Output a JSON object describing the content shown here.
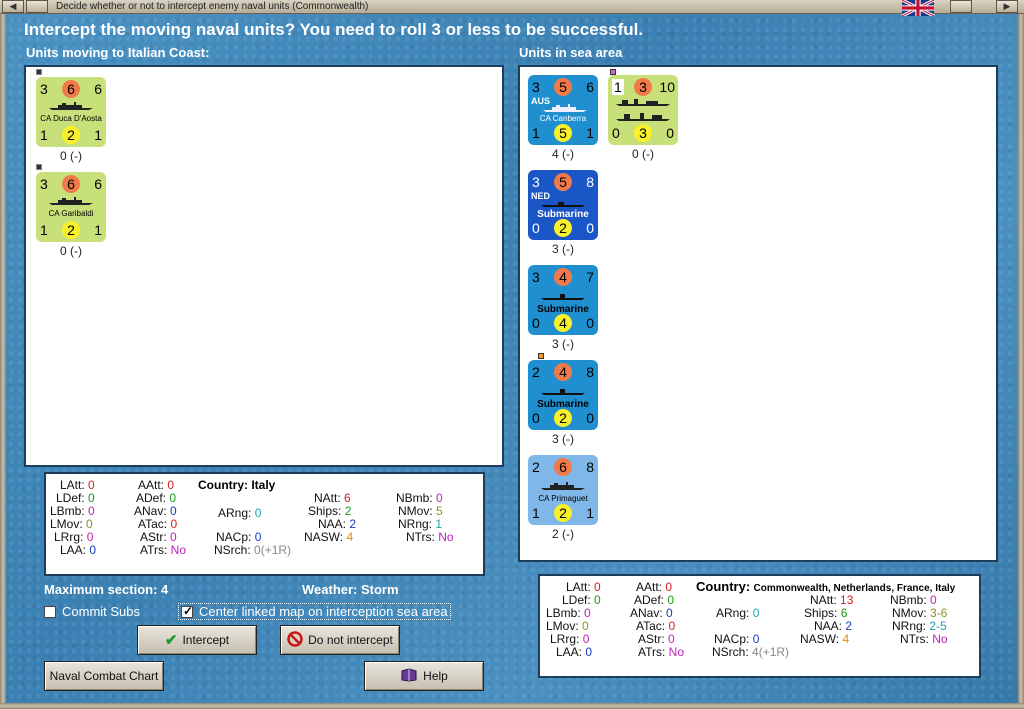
{
  "window": {
    "title": "Decide whether or not to intercept enemy naval units (Commonwealth)",
    "left_btn": "◀",
    "right_btn": "▶"
  },
  "headline": "Intercept the moving naval units?  You need to roll 3 or less to be successful.",
  "left_section": {
    "label": "Units moving to Italian Coast:",
    "units": [
      {
        "tl": "3",
        "tc": "6",
        "tr": "6",
        "name": "CA Duca D'Aosta",
        "bl": "1",
        "bc": "2",
        "br": "1",
        "caption": "0 (-)"
      },
      {
        "tl": "3",
        "tc": "6",
        "tr": "6",
        "name": "CA Garibaldi",
        "bl": "1",
        "bc": "2",
        "br": "1",
        "caption": "0 (-)"
      }
    ]
  },
  "right_section": {
    "label": "Units in sea area",
    "units": [
      {
        "tl": "3",
        "tc": "5",
        "tr": "6",
        "country": "AUS",
        "name": "CA Canberra",
        "bl": "1",
        "bc": "5",
        "br": "1",
        "caption": "4 (-)"
      },
      {
        "tl": "1",
        "tc": "3",
        "tr": "10",
        "country": "",
        "name": "",
        "bl": "0",
        "bc": "3",
        "br": "0",
        "caption": "0 (-)"
      },
      {
        "tl": "3",
        "tc": "5",
        "tr": "8",
        "country": "NED",
        "name": "Submarine",
        "bl": "0",
        "bc": "2",
        "br": "0",
        "caption": "3 (-)"
      },
      {
        "tl": "3",
        "tc": "4",
        "tr": "7",
        "country": "",
        "name": "Submarine",
        "bl": "0",
        "bc": "4",
        "br": "0",
        "caption": "3 (-)"
      },
      {
        "tl": "2",
        "tc": "4",
        "tr": "8",
        "country": "",
        "name": "Submarine",
        "bl": "0",
        "bc": "2",
        "br": "0",
        "caption": "3 (-)"
      },
      {
        "tl": "2",
        "tc": "6",
        "tr": "8",
        "country": "",
        "name": "CA Primaguet",
        "bl": "1",
        "bc": "2",
        "br": "1",
        "caption": "2 (-)"
      }
    ]
  },
  "left_stats": {
    "country_label": "Country:",
    "country": "Italy",
    "rows": [
      {
        "k": "LAtt:",
        "v": "0"
      },
      {
        "k": "LDef:",
        "v": "0"
      },
      {
        "k": "LBmb:",
        "v": "0"
      },
      {
        "k": "LMov:",
        "v": "0"
      },
      {
        "k": "LRrg:",
        "v": "0"
      },
      {
        "k": "LAA:",
        "v": "0"
      },
      {
        "k": "AAtt:",
        "v": "0"
      },
      {
        "k": "ADef:",
        "v": "0"
      },
      {
        "k": "ANav:",
        "v": "0"
      },
      {
        "k": "ATac:",
        "v": "0"
      },
      {
        "k": "AStr:",
        "v": "0"
      },
      {
        "k": "ATrs:",
        "v": "No"
      },
      {
        "k": "ARng:",
        "v": "0"
      },
      {
        "k": "NACp:",
        "v": "0"
      },
      {
        "k": "NSrch:",
        "v": "0(+1R)"
      },
      {
        "k": "NAtt:",
        "v": "6"
      },
      {
        "k": "Ships:",
        "v": "2"
      },
      {
        "k": "NAA:",
        "v": "2"
      },
      {
        "k": "NASW:",
        "v": "4"
      },
      {
        "k": "NBmb:",
        "v": "0"
      },
      {
        "k": "NMov:",
        "v": "5"
      },
      {
        "k": "NRng:",
        "v": "1"
      },
      {
        "k": "NTrs:",
        "v": "No"
      }
    ]
  },
  "right_stats": {
    "country_label": "Country:",
    "country": "Commonwealth, Netherlands, France, Italy",
    "rows": [
      {
        "k": "LAtt:",
        "v": "0"
      },
      {
        "k": "LDef:",
        "v": "0"
      },
      {
        "k": "LBmb:",
        "v": "0"
      },
      {
        "k": "LMov:",
        "v": "0"
      },
      {
        "k": "LRrg:",
        "v": "0"
      },
      {
        "k": "LAA:",
        "v": "0"
      },
      {
        "k": "AAtt:",
        "v": "0"
      },
      {
        "k": "ADef:",
        "v": "0"
      },
      {
        "k": "ANav:",
        "v": "0"
      },
      {
        "k": "ATac:",
        "v": "0"
      },
      {
        "k": "AStr:",
        "v": "0"
      },
      {
        "k": "ATrs:",
        "v": "No"
      },
      {
        "k": "ARng:",
        "v": "0"
      },
      {
        "k": "NACp:",
        "v": "0"
      },
      {
        "k": "NSrch:",
        "v": "4(+1R)"
      },
      {
        "k": "NAtt:",
        "v": "13"
      },
      {
        "k": "Ships:",
        "v": "6"
      },
      {
        "k": "NAA:",
        "v": "2"
      },
      {
        "k": "NASW:",
        "v": "4"
      },
      {
        "k": "NBmb:",
        "v": "0"
      },
      {
        "k": "NMov:",
        "v": "3-6"
      },
      {
        "k": "NRng:",
        "v": "2-5"
      },
      {
        "k": "NTrs:",
        "v": "No"
      }
    ]
  },
  "info": {
    "max_section": "Maximum section: 4",
    "weather": "Weather:  Storm"
  },
  "checkboxes": {
    "commit_subs": "Commit Subs",
    "center_map": "Center linked map on interception sea area"
  },
  "buttons": {
    "intercept": "Intercept",
    "do_not_intercept": "Do not intercept",
    "chart": "Naval Combat Chart",
    "help": "Help"
  },
  "colors": {
    "counter_green": "#c8e07a",
    "counter_blue": "#1f8fcf",
    "counter_navy": "#1a56c6",
    "counter_lightblue": "#7fb8e8",
    "atk_circle": "#f07a4a",
    "def_circle": "#f7f02a"
  }
}
